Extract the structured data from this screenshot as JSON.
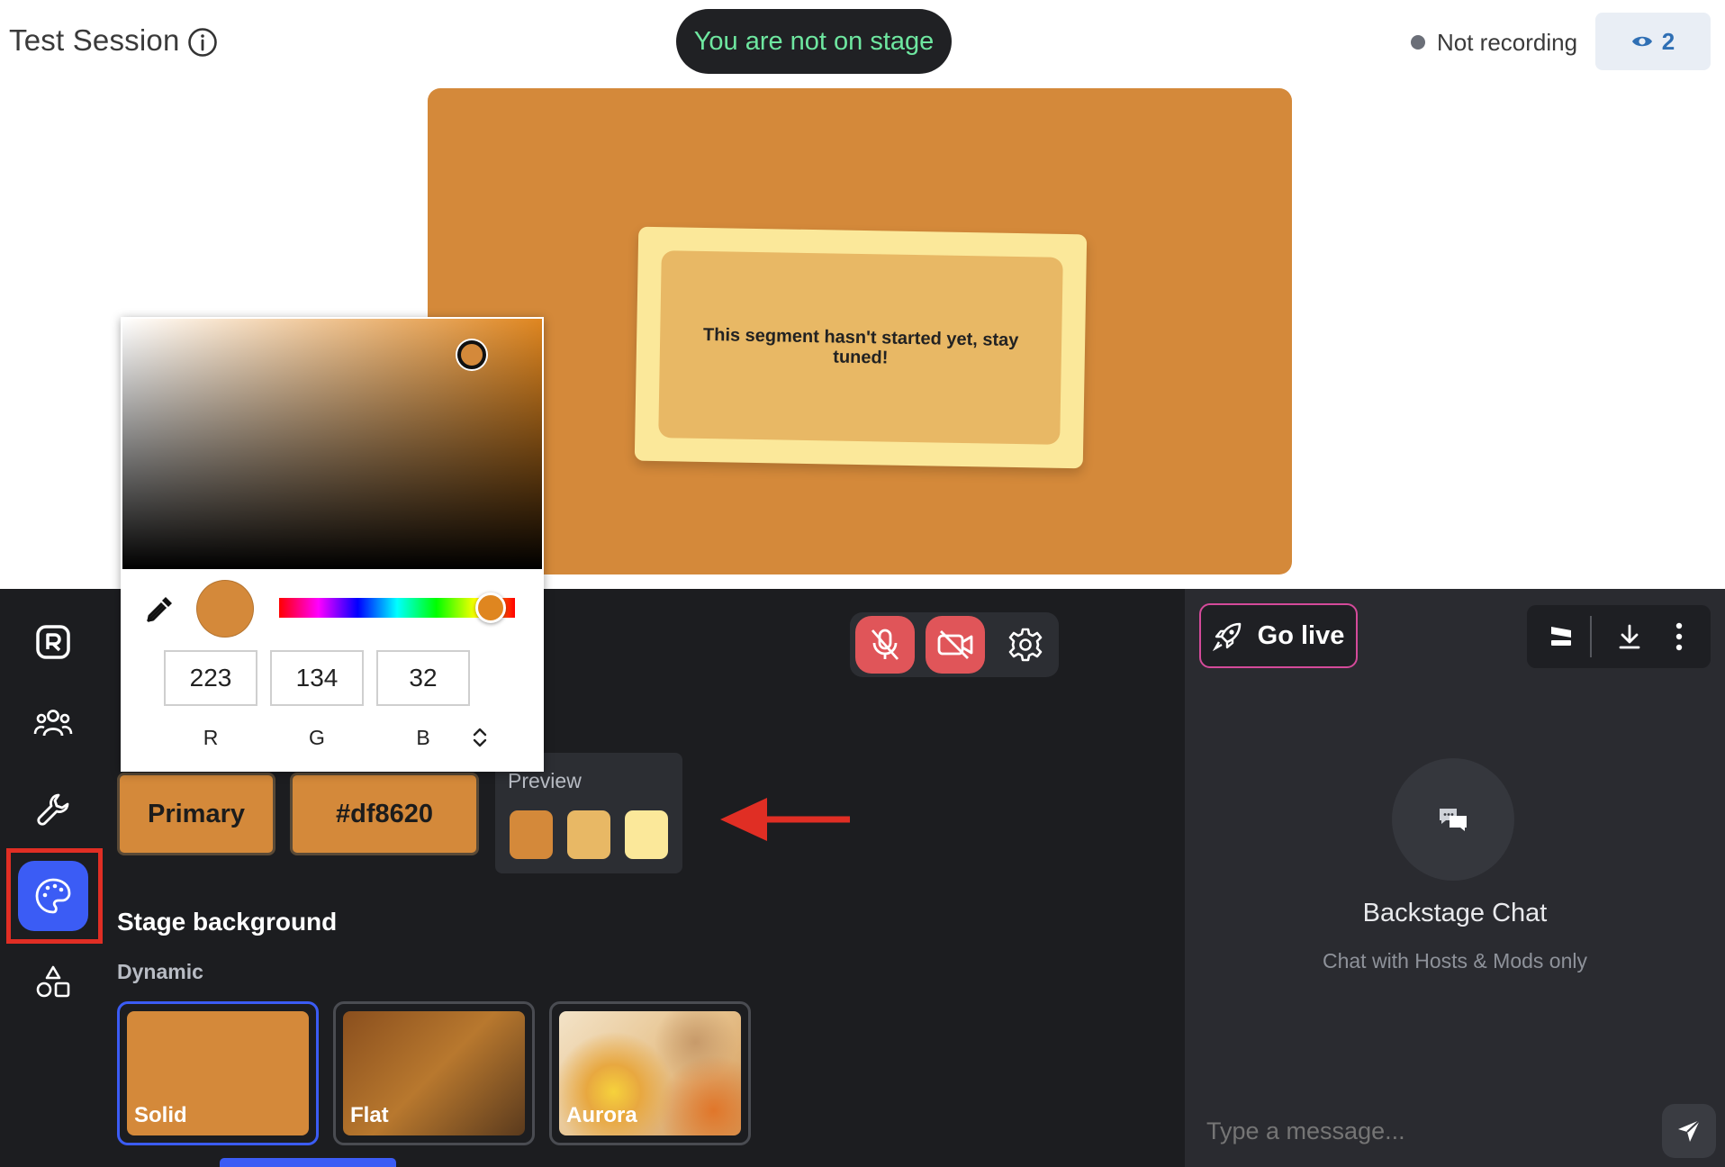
{
  "header": {
    "session_title": "Test Session",
    "stage_status": "You are not on stage",
    "recording_status": "Not recording",
    "viewer_count": "2"
  },
  "stage": {
    "segment_message": "This segment hasn't started yet, stay tuned!"
  },
  "colors": {
    "primary": "#df8620",
    "stage_bg": "#d4893a",
    "card_outer": "#fbe89a",
    "card_inner": "#e8b865",
    "accent_blue": "#3b5cf5",
    "mic_red": "#e05559"
  },
  "color_picker": {
    "r": "223",
    "g": "134",
    "b": "32",
    "r_label": "R",
    "g_label": "G",
    "b_label": "B"
  },
  "theme": {
    "primary_label": "Primary",
    "hex_value": "#df8620",
    "preview_label": "Preview",
    "preview_swatches": [
      "#d4893a",
      "#e8b865",
      "#fbe89a"
    ],
    "stage_background_title": "Stage background",
    "dynamic_label": "Dynamic",
    "background_options": [
      {
        "label": "Solid",
        "selected": true
      },
      {
        "label": "Flat",
        "selected": false
      },
      {
        "label": "Aurora",
        "selected": false
      }
    ]
  },
  "sidebar": {
    "items": [
      {
        "icon": "logo-icon"
      },
      {
        "icon": "people-icon"
      },
      {
        "icon": "wrench-icon"
      },
      {
        "icon": "palette-icon",
        "active": true
      },
      {
        "icon": "shapes-icon"
      }
    ]
  },
  "chat": {
    "go_live_label": "Go live",
    "title": "Backstage Chat",
    "subtitle": "Chat with Hosts & Mods only",
    "input_placeholder": "Type a message..."
  }
}
